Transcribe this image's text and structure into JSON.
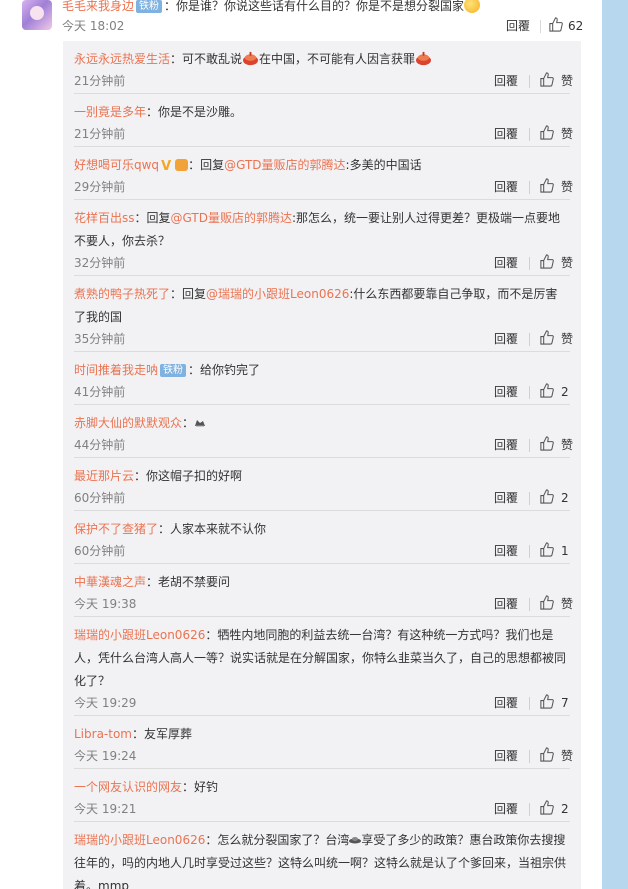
{
  "top_comment": {
    "username": "毛毛来我身边",
    "badge": "铁粉",
    "text": "：你是谁？你说这些话有什么目的？你是不是想分裂国家",
    "time": "今天 18:02",
    "reply_label": "回覆",
    "like_count": "62"
  },
  "replies": [
    {
      "user": "永远永远热爱生活",
      "pre": "：可不敢乱说",
      "mid": "在中国，不可能有人因言获罪",
      "time": "21分钟前",
      "reply": "回覆",
      "like": "赞"
    },
    {
      "user": "一别竟是多年",
      "text": "：你是不是沙雕。",
      "time": "21分钟前",
      "reply": "回覆",
      "like": "赞"
    },
    {
      "user": "好想喝可乐qwq",
      "pre": "：回复",
      "mention": "@GTD量贩店的郭腾达",
      "text": ":多美的中国话",
      "time": "29分钟前",
      "reply": "回覆",
      "like": "赞"
    },
    {
      "user": "花样百出ss",
      "pre": "：回复",
      "mention": "@GTD量贩店的郭腾达",
      "text": ":那怎么，统一要让别人过得更差？更极端一点要地不要人，你去杀？",
      "time": "32分钟前",
      "reply": "回覆",
      "like": "赞"
    },
    {
      "user": "煮熟的鸭子热死了",
      "pre": "：回复",
      "mention": "@瑞瑞的小跟班Leon0626",
      "text": ":什么东西都要靠自己争取，而不是厉害了我的国",
      "time": "35分钟前",
      "reply": "回覆",
      "like": "赞"
    },
    {
      "user": "时间推着我走呐",
      "badge": "铁粉",
      "text": "：给你钓完了",
      "time": "41分钟前",
      "reply": "回覆",
      "like": "2"
    },
    {
      "user": "赤脚大仙的默默观众",
      "text": "：",
      "time": "44分钟前",
      "reply": "回覆",
      "like": "赞"
    },
    {
      "user": "最近那片云",
      "text": "：你这帽子扣的好啊",
      "time": "60分钟前",
      "reply": "回覆",
      "like": "2"
    },
    {
      "user": "保护不了查猪了",
      "text": "：人家本来就不认你",
      "time": "60分钟前",
      "reply": "回覆",
      "like": "1"
    },
    {
      "user": "中華漢魂之声",
      "text": "：老胡不禁要问",
      "time": "今天 19:38",
      "reply": "回覆",
      "like": "赞"
    },
    {
      "user": "瑞瑞的小跟班Leon0626",
      "text": "：牺牲内地同胞的利益去统一台湾？有这种统一方式吗？我们也是人，凭什么台湾人高人一等？说实话就是在分解国家，你特么韭菜当久了，自己的思想都被同化了？",
      "time": "今天 19:29",
      "reply": "回覆",
      "like": "7"
    },
    {
      "user": "Libra-tom",
      "text": "：友军厚葬",
      "time": "今天 19:24",
      "reply": "回覆",
      "like": "赞"
    },
    {
      "user": "一个网友认识的网友",
      "text": "：好钓",
      "time": "今天 19:21",
      "reply": "回覆",
      "like": "2"
    },
    {
      "user": "瑞瑞的小跟班Leon0626",
      "pre": "：怎么就分裂国家了？台湾",
      "text": "享受了多少的政策？惠台政策你去搜搜往年的，吗的内地人几时享受过这些？这特么叫统一啊？这特么就是认了个爹回来，当祖宗供着。mmp",
      "time": "",
      "reply": "",
      "like": ""
    }
  ]
}
